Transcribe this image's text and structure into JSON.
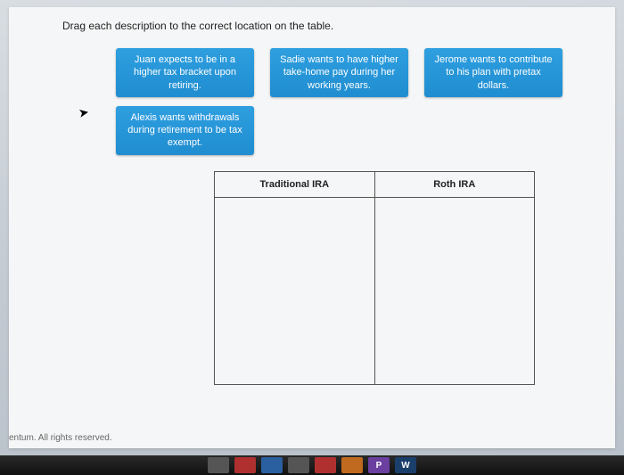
{
  "instruction": "Drag each description to the correct location on the table.",
  "cards": {
    "juan": "Juan expects to be in a higher tax bracket upon retiring.",
    "sadie": "Sadie wants to have higher take-home pay during her working years.",
    "jerome": "Jerome wants to contribute to his plan with pretax dollars.",
    "alexis": "Alexis wants withdrawals during retirement to be tax exempt."
  },
  "table": {
    "col1": "Traditional IRA",
    "col2": "Roth IRA"
  },
  "footer": "entum. All rights reserved.",
  "taskbar": {
    "p_label": "P",
    "w_label": "W"
  }
}
